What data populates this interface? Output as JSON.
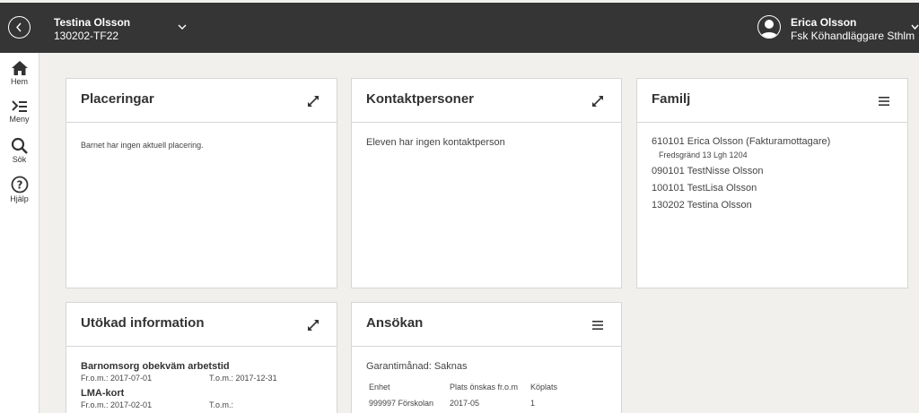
{
  "header": {
    "child_name": "Testina Olsson",
    "child_id": "130202-TF22",
    "user_name": "Erica Olsson",
    "user_role": "Fsk Köhandläggare Sthlm"
  },
  "sidebar": {
    "items": [
      {
        "label": "Hem",
        "icon": "home-icon"
      },
      {
        "label": "Meny",
        "icon": "menu-icon"
      },
      {
        "label": "Sök",
        "icon": "search-icon"
      },
      {
        "label": "Hjälp",
        "icon": "help-icon"
      }
    ]
  },
  "cards": {
    "placeringar": {
      "title": "Placeringar",
      "text": "Barnet har ingen aktuell placering."
    },
    "kontaktpersoner": {
      "title": "Kontaktpersoner",
      "text": "Eleven har ingen kontaktperson"
    },
    "familj": {
      "title": "Familj",
      "members": [
        {
          "text": "610101 Erica Olsson (Fakturamottagare)",
          "address": "Fredsgränd 13 Lgh 1204"
        },
        {
          "text": "090101 TestNisse Olsson"
        },
        {
          "text": "100101 TestLisa Olsson"
        },
        {
          "text": "130202 Testina Olsson"
        }
      ]
    },
    "utokad": {
      "title": "Utökad information",
      "sections": [
        {
          "title": "Barnomsorg obekväm arbetstid",
          "from_label": "Fr.o.m.:",
          "from": "2017-07-01",
          "to_label": "T.o.m.:",
          "to": "2017-12-31"
        },
        {
          "title": "LMA-kort",
          "from_label": "Fr.o.m.:",
          "from": "2017-02-01",
          "to_label": "T.o.m.:",
          "to": ""
        }
      ]
    },
    "ansokan": {
      "title": "Ansökan",
      "garanti": "Garantimånad: Saknas",
      "columns": [
        "Enhet",
        "Plats önskas fr.o.m",
        "Köplats"
      ],
      "rows": [
        [
          "999997 Förskolan",
          "2017-05",
          "1"
        ]
      ]
    }
  }
}
